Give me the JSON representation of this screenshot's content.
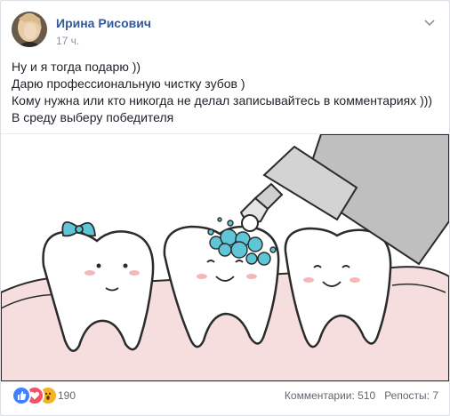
{
  "post": {
    "author": "Ирина Рисович",
    "time": "17 ч.",
    "text_lines": [
      "Ну и я тогда подарю ))",
      "Дарю профессиональную чистку зубов )",
      "Кому нужна или кто никогда не делал записывайтесь в комментариях )))",
      "В среду выберу победителя"
    ]
  },
  "footer": {
    "reaction_icons": [
      "like-icon",
      "love-icon",
      "wow-icon"
    ],
    "reaction_count": "190",
    "comments": "Комментарии: 510",
    "shares": "Репосты: 7"
  },
  "colors": {
    "author_link": "#365899",
    "like": "#4080ff",
    "love": "#f25268",
    "wow": "#f7b125",
    "bow": "#5fc6d8",
    "gums": "#f6dede"
  }
}
